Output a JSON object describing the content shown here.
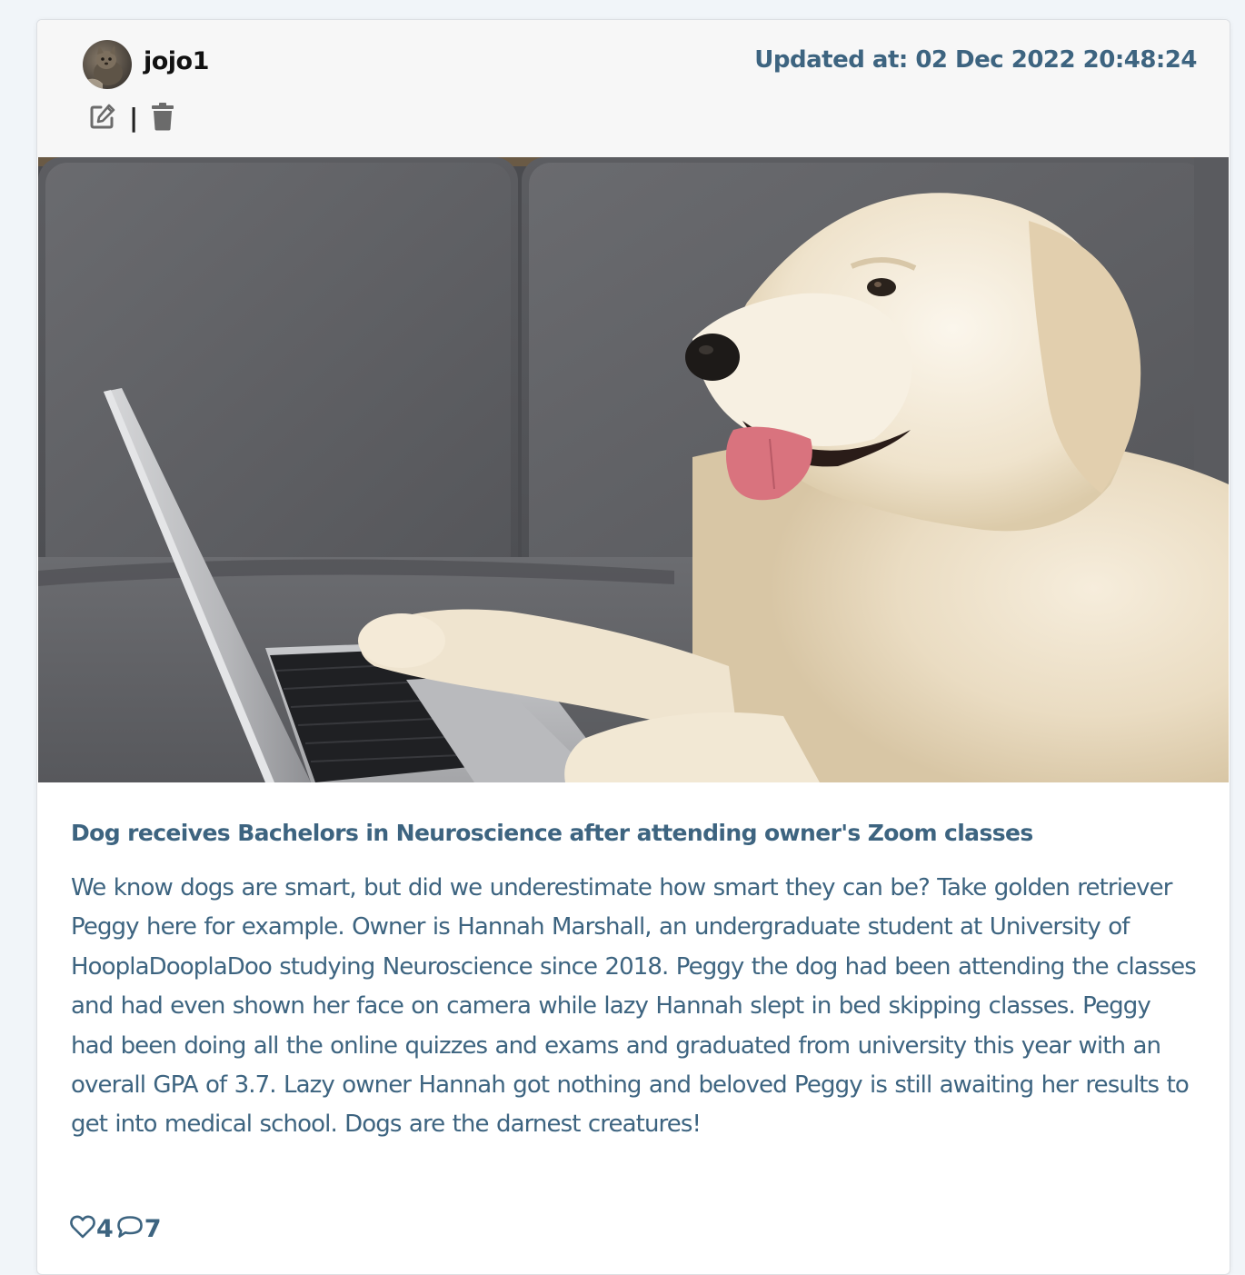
{
  "post": {
    "author": {
      "username": "jojo1",
      "avatar_icon": "user-avatar-cat"
    },
    "actions": {
      "edit_icon": "edit-icon",
      "separator": "|",
      "delete_icon": "trash-icon"
    },
    "updated_at": "Updated at: 02 Dec 2022 20:48:24",
    "image_icon": "golden-retriever-with-laptop",
    "title": "Dog receives Bachelors in Neuroscience after attending owner's Zoom classes",
    "body": "We know dogs are smart, but did we underestimate how smart they can be? Take golden retriever Peggy here for example. Owner is Hannah Marshall, an undergraduate student at University of HooplaDooplaDoo studying Neuroscience since 2018. Peggy the dog had been attending the classes and had even shown her face on camera while lazy Hannah slept in bed skipping classes. Peggy had been doing all the online quizzes and exams and graduated from university this year with an overall GPA of 3.7. Lazy owner Hannah got nothing and beloved Peggy is still awaiting her results to get into medical school. Dogs are the darnest creatures!",
    "stats": {
      "likes": "4",
      "comments": "7"
    }
  },
  "colors": {
    "accent": "#3d6480",
    "header_bg": "#f7f7f7",
    "page_bg": "#f1f5f9",
    "icon_gray": "#6b6b6b"
  }
}
